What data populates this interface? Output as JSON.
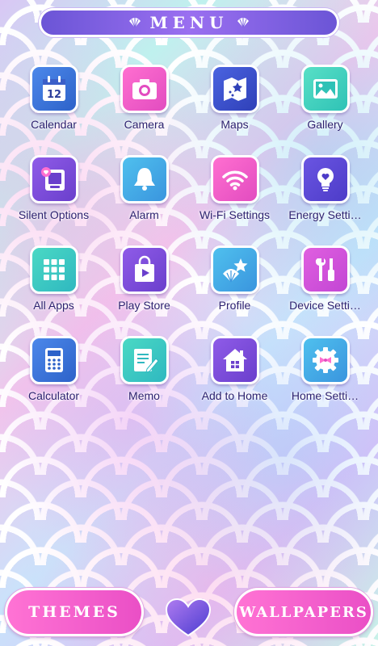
{
  "header": {
    "title": "MENU"
  },
  "apps": [
    {
      "label": "Calendar",
      "icon": "calendar-icon"
    },
    {
      "label": "Camera",
      "icon": "camera-icon"
    },
    {
      "label": "Maps",
      "icon": "map-icon"
    },
    {
      "label": "Gallery",
      "icon": "gallery-icon"
    },
    {
      "label": "Silent Options",
      "icon": "silent-icon"
    },
    {
      "label": "Alarm",
      "icon": "bell-icon"
    },
    {
      "label": "Wi-Fi Settings",
      "icon": "wifi-icon"
    },
    {
      "label": "Energy Setti…",
      "icon": "lightbulb-icon"
    },
    {
      "label": "All Apps",
      "icon": "grid-icon"
    },
    {
      "label": "Play Store",
      "icon": "shopping-bag-icon"
    },
    {
      "label": "Profile",
      "icon": "starfish-shell-icon"
    },
    {
      "label": "Device Setti…",
      "icon": "tools-icon"
    },
    {
      "label": "Calculator",
      "icon": "calculator-icon"
    },
    {
      "label": "Memo",
      "icon": "memo-icon"
    },
    {
      "label": "Add to Home",
      "icon": "house-icon"
    },
    {
      "label": "Home Setti…",
      "icon": "gear-bow-icon"
    }
  ],
  "calendar_day": "12",
  "bottom": {
    "themes_label": "THEMES",
    "wallpapers_label": "WALLPAPERS"
  },
  "colors": {
    "accent_pink": "#ea4fc6",
    "accent_purple": "#6b55d6",
    "label_text": "#2d2270"
  }
}
